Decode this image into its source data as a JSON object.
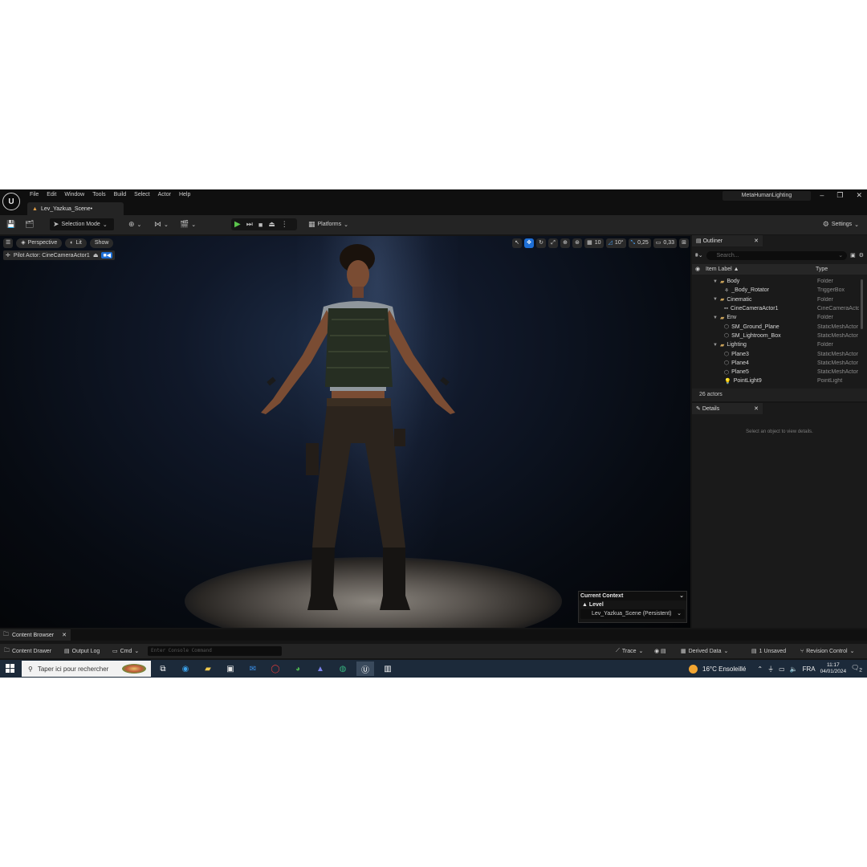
{
  "menu": [
    "File",
    "Edit",
    "Window",
    "Tools",
    "Build",
    "Select",
    "Actor",
    "Help"
  ],
  "project_name": "MetaHumanLighting",
  "window_controls": {
    "minimize": "–",
    "maximize": "❐",
    "close": "✕"
  },
  "level_tab": "Lev_Yazkua_Scene•",
  "toolbar": {
    "selection_mode": "Selection Mode",
    "platforms": "Platforms",
    "settings": "Settings"
  },
  "viewport": {
    "perspective": "Perspective",
    "lit": "Lit",
    "show": "Show",
    "pilot_actor": "Pilot Actor: CineCameraActor1",
    "grid_snap": "10",
    "rotation_snap": "10°",
    "scale_snap": "0,25",
    "camera_speed": "0,33"
  },
  "current_context": {
    "title": "Current Context",
    "level_label": "Level",
    "level_value": "Lev_Yazkua_Scene (Persistent)"
  },
  "outliner": {
    "tab": "Outliner",
    "search_placeholder": "Search...",
    "col_label": "Item Label ▲",
    "col_type": "Type",
    "rows": [
      {
        "label": "Body",
        "type": "Folder"
      },
      {
        "label": "_Body_Rotator",
        "type": "TriggerBox"
      },
      {
        "label": "Cinematic",
        "type": "Folder"
      },
      {
        "label": "CineCameraActor1",
        "type": "CineCameraActor"
      },
      {
        "label": "Env",
        "type": "Folder"
      },
      {
        "label": "SM_Ground_Plane",
        "type": "StaticMeshActor"
      },
      {
        "label": "SM_Lightroom_Box",
        "type": "StaticMeshActor"
      },
      {
        "label": "Lighting",
        "type": "Folder"
      },
      {
        "label": "Plane3",
        "type": "StaticMeshActor"
      },
      {
        "label": "Plane4",
        "type": "StaticMeshActor"
      },
      {
        "label": "Plane5",
        "type": "StaticMeshActor"
      },
      {
        "label": "PointLight9",
        "type": "PointLight"
      }
    ],
    "footer": "26 actors"
  },
  "details": {
    "tab": "Details",
    "hint": "Select an object to view details."
  },
  "content_browser_tab": "Content Browser",
  "statusbar": {
    "content_drawer": "Content Drawer",
    "output_log": "Output Log",
    "cmd": "Cmd",
    "console_placeholder": "Enter Console Command",
    "trace": "Trace",
    "derived_data": "Derived Data",
    "unsaved": "1 Unsaved",
    "revision_control": "Revision Control"
  },
  "taskbar": {
    "search_placeholder": "Taper ici pour rechercher",
    "weather": "16°C  Ensoleillé",
    "language": "FRA",
    "time": "11:17",
    "date": "04/01/2024",
    "notifications": "2"
  }
}
